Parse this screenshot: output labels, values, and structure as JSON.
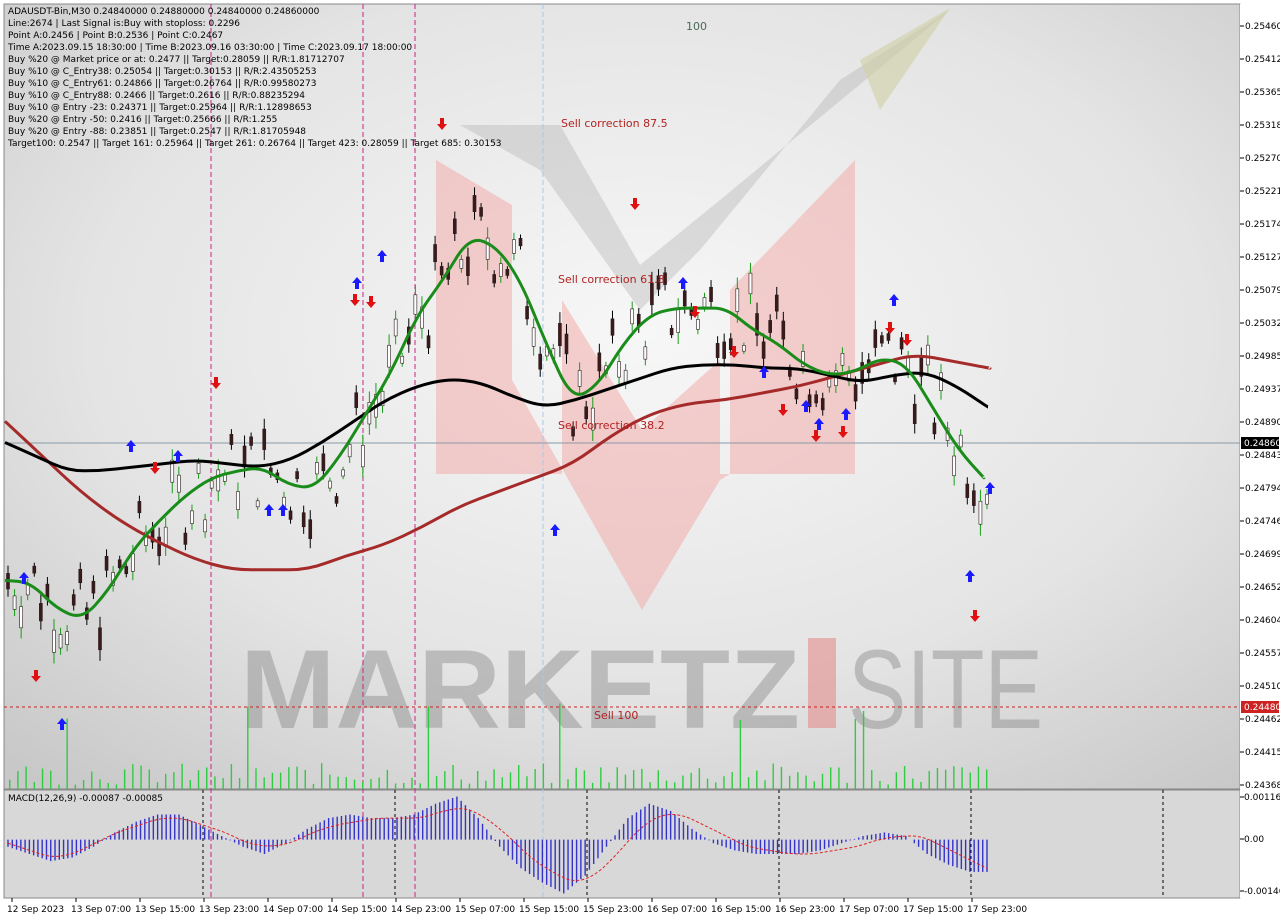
{
  "chart_data": {
    "type": "line",
    "symbol_header": "ADAUSDT-Bin,M30  0.24840000 0.24880000 0.24840000 0.24860000",
    "info_lines": [
      "Line:2674 | Last Signal is:Buy with stoploss: 0.2296",
      "Point A:0.2456 | Point B:0.2536 | Point C:0.2467",
      "Time A:2023.09.15 18:30:00 | Time B:2023.09.16 03:30:00 | Time C:2023.09.17 18:00:00",
      "Buy %20 @ Market price or at: 0.2477 || Target:0.28059 || R/R:1.81712707",
      "Buy %10 @ C_Entry38: 0.25054 || Target:0.30153 || R/R:2.43505253",
      "Buy %10 @ C_Entry61: 0.24866 || Target:0.26764 || R/R:0.99580273",
      "Buy %10 @ C_Entry88: 0.2466 || Target:0.2616 || R/R:0.88235294",
      "Buy %10 @ Entry -23: 0.24371 || Target:0.25964 || R/R:1.12898653",
      "Buy %20 @ Entry -50: 0.2416 || Target:0.25666 || R/R:1.255",
      "Buy %20 @ Entry -88: 0.23851 || Target:0.2547 || R/R:1.81705948",
      "Target100: 0.2547 || Target 161: 0.25964 || Target 261: 0.26764 || Target 423: 0.28059 || Target 685: 0.30153"
    ],
    "ylim": [
      0.2436,
      0.2547
    ],
    "y_ticks": [
      "0.25460",
      "0.25412",
      "0.25365",
      "0.25318",
      "0.25270",
      "0.25221",
      "0.25174",
      "0.25127",
      "0.25079",
      "0.25032",
      "0.24985",
      "0.24937",
      "0.24890",
      "0.24843",
      "0.24794",
      "0.24746",
      "0.24699",
      "0.24652",
      "0.24604",
      "0.24557",
      "0.24510",
      "0.24462",
      "0.24415",
      "0.24368"
    ],
    "x_ticks": [
      "12 Sep 2023",
      "13 Sep 07:00",
      "13 Sep 15:00",
      "13 Sep 23:00",
      "14 Sep 07:00",
      "14 Sep 15:00",
      "14 Sep 23:00",
      "15 Sep 07:00",
      "15 Sep 15:00",
      "15 Sep 23:00",
      "16 Sep 07:00",
      "16 Sep 15:00",
      "16 Sep 23:00",
      "17 Sep 07:00",
      "17 Sep 15:00",
      "17 Sep 23:00"
    ],
    "current_price": {
      "label": "0.24860",
      "value": 0.2486
    },
    "sell100_price": {
      "label": "0.24480",
      "value": 0.2448
    },
    "annotations": {
      "level_100": "100",
      "sell_875": "Sell correction 87.5",
      "sell_618": "Sell correction 61.8",
      "sell_382": "Sell correction 38.2",
      "sell_100": "Sell 100"
    },
    "watermark": {
      "left": "MARKETZ",
      "right": "SITE"
    },
    "green_ma": [
      0.24655,
      0.24652,
      0.24615,
      0.246,
      0.2464,
      0.247,
      0.2474,
      0.24775,
      0.248,
      0.2481,
      0.24815,
      0.2479,
      0.24785,
      0.2483,
      0.2489,
      0.2495,
      0.2503,
      0.2508,
      0.2514,
      0.2513,
      0.2508,
      0.2499,
      0.2491,
      0.2493,
      0.2499,
      0.2503,
      0.2504,
      0.2504,
      0.2504,
      0.2501,
      0.2499,
      0.2496,
      0.24945,
      0.2495,
      0.2497,
      0.2496,
      0.249,
      0.2484,
      0.248
    ],
    "black_ma": [
      0.2485,
      0.2483,
      0.2481,
      0.2481,
      0.24815,
      0.2482,
      0.24825,
      0.2482,
      0.24815,
      0.24825,
      0.2485,
      0.2488,
      0.2491,
      0.2493,
      0.2494,
      0.24935,
      0.24915,
      0.249,
      0.2491,
      0.24925,
      0.2494,
      0.24955,
      0.2496,
      0.2496,
      0.24955,
      0.24955,
      0.24945,
      0.24935,
      0.24945,
      0.2495,
      0.2493,
      0.249
    ],
    "red_ma": [
      0.2488,
      0.2483,
      0.2478,
      0.2474,
      0.2471,
      0.24685,
      0.2467,
      0.2467,
      0.2467,
      0.2469,
      0.24705,
      0.2473,
      0.2476,
      0.2478,
      0.248,
      0.2482,
      0.2486,
      0.2489,
      0.24905,
      0.2491,
      0.2492,
      0.2493,
      0.24945,
      0.2496,
      0.24975,
      0.24965,
      0.24955
    ],
    "macd": {
      "label": "MACD(12,26,9) -0.00087 -0.00085",
      "ylim": [
        -0.00146,
        0.00116
      ],
      "y_ticks": [
        "0.00116",
        "0.00",
        "-0.00146"
      ],
      "histogram": [
        -0.0002,
        -0.0004,
        -0.0006,
        -0.0005,
        -0.0002,
        0.0002,
        0.0005,
        0.0007,
        0.0007,
        0.0004,
        0.0001,
        -0.0002,
        -0.0004,
        -0.0001,
        0.0003,
        0.0006,
        0.0007,
        0.0006,
        0.0006,
        0.0007,
        0.001,
        0.0012,
        0.0006,
        -0.0002,
        -0.0008,
        -0.0012,
        -0.0015,
        -0.001,
        -0.0002,
        0.0006,
        0.001,
        0.0008,
        0.0003,
        -0.0001,
        -0.0003,
        -0.0004,
        -0.0004,
        -0.0004,
        -0.0003,
        -0.0001,
        0.0001,
        0.0002,
        0.0001,
        -0.0004,
        -0.0007,
        -0.0009
      ],
      "signal": [
        -0.0001,
        -0.0003,
        -0.0005,
        -0.0004,
        -0.0001,
        0.0002,
        0.0004,
        0.0006,
        0.0006,
        0.0004,
        0.0002,
        -0.0001,
        -0.0002,
        -0.0001,
        0.0002,
        0.0004,
        0.0005,
        0.0006,
        0.0006,
        0.0006,
        0.0008,
        0.0009,
        0.0006,
        0.0001,
        -0.0005,
        -0.0009,
        -0.0012,
        -0.001,
        -0.0004,
        0.0003,
        0.0007,
        0.0007,
        0.0004,
        0.0001,
        -0.0002,
        -0.0003,
        -0.0004,
        -0.0004,
        -0.0003,
        -0.0002,
        0.0,
        0.0001,
        0.0001,
        -0.0002,
        -0.0005,
        -0.0008
      ]
    },
    "colors": {
      "green_ma": "#1a8c1a",
      "black_ma": "#000000",
      "red_ma": "#a52a2a",
      "macd_hist": "#3333cc",
      "macd_signal": "#e02020",
      "current_label_bg": "#000000",
      "sell_label_bg": "#cc2222"
    }
  }
}
